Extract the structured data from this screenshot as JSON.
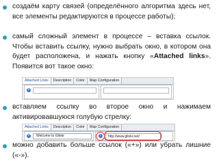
{
  "bullets": {
    "b1": {
      "text": "создаём карту связей (определённого алгоритма здесь нет, все элементы редактируются в процессе работы);"
    },
    "b2": {
      "text_before": "самый сложный элемент в процессе – вставка ссылок. Чтобы вставить ссылку, нужно выбрать окно, в котором она будет расположена, и нажать кнопку «",
      "bold": "Attached links",
      "text_after": "». Появится вот такое окно:"
    },
    "b3": {
      "text": "вставляем ссылку во второе окно и нажимаем активировавшуюся голубую стрелку:"
    },
    "b4": {
      "text": "можно добавить больше ссылок («+») или убрать лишние («-»)."
    }
  },
  "screenshot1": {
    "tabs": [
      "Attached Links",
      "Description",
      "Color",
      "Map Configuration"
    ]
  },
  "screenshot2": {
    "tabs": [
      "Attached Links",
      "Description",
      "Color",
      "Map Configuration"
    ],
    "select_value": "Welcome to Glinkr",
    "url_value": "http://www.glinkr.net/"
  },
  "colors": {
    "bullet": "#29a3b3",
    "highlight": "#e02020",
    "button": "#2f7bd6"
  }
}
